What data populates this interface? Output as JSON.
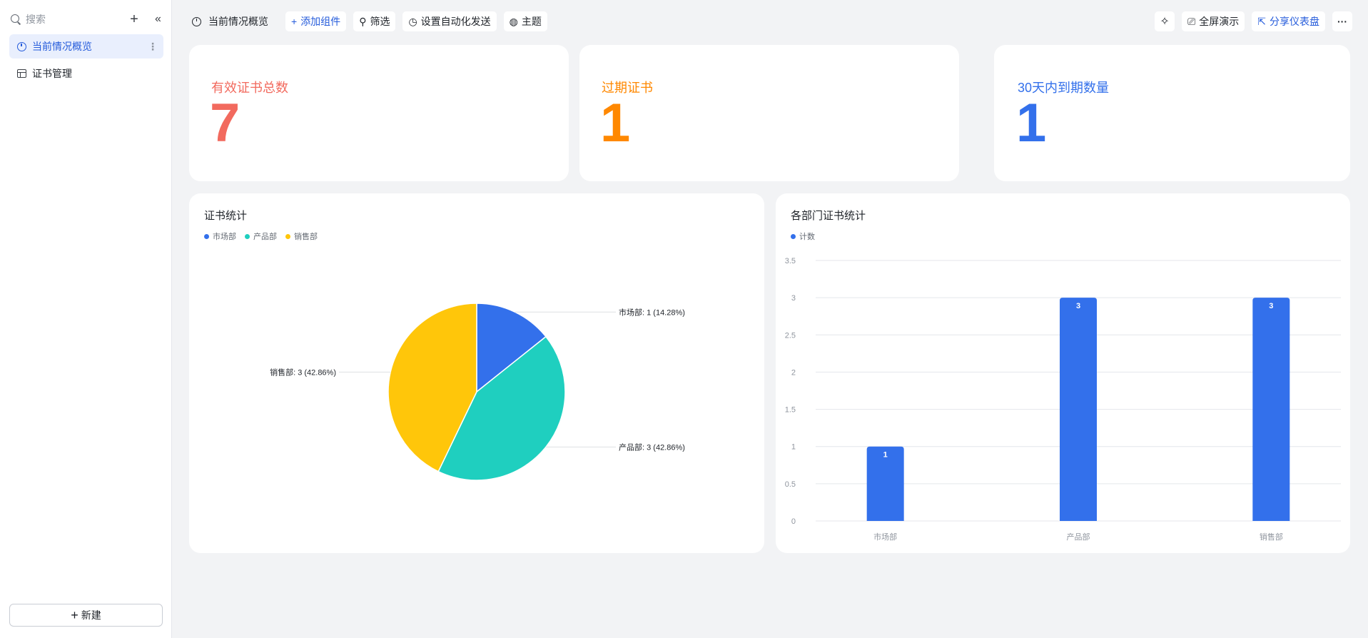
{
  "sidebar": {
    "search_placeholder": "搜索",
    "add_glyph": "+",
    "collapse_glyph": "«",
    "items": [
      {
        "label": "当前情况概览",
        "icon": "dashboard-clock-icon",
        "active": true
      },
      {
        "label": "证书管理",
        "icon": "table-icon",
        "active": false
      }
    ],
    "more_glyph": "⋮",
    "new_label": "新建",
    "new_glyph": "+"
  },
  "toolbar": {
    "title": "当前情况概览",
    "buttons": [
      {
        "label": "添加组件",
        "glyph": "+",
        "icon": "plus-icon"
      },
      {
        "label": "筛选",
        "glyph": "⚲",
        "icon": "filter-icon"
      },
      {
        "label": "设置自动化发送",
        "glyph": "◷",
        "icon": "automation-clock-icon"
      },
      {
        "label": "主题",
        "glyph": "◍",
        "icon": "theme-palette-icon"
      }
    ],
    "right": {
      "ai_glyph": "✧",
      "fullscreen_label": "全屏演示",
      "fullscreen_glyph": "⎚",
      "share_label": "分享仪表盘",
      "share_glyph": "⇱",
      "more_glyph": "···"
    }
  },
  "kpis": [
    {
      "label": "有效证书总数",
      "value": "7",
      "color": "#f26a5e"
    },
    {
      "label": "过期证书",
      "value": "1",
      "color": "#ff8800"
    },
    {
      "label": "30天内到期数量",
      "value": "1",
      "color": "#3370eb"
    }
  ],
  "chart_data": [
    {
      "type": "pie",
      "title": "证书统计",
      "legend": "top-left",
      "categories": [
        "市场部",
        "产品部",
        "销售部"
      ],
      "values": [
        1,
        3,
        3
      ],
      "percents": [
        "14.28%",
        "42.86%",
        "42.86%"
      ],
      "labels": [
        "市场部: 1 (14.28%)",
        "产品部: 3 (42.86%)",
        "销售部: 3 (42.86%)"
      ],
      "colors": [
        "#3370eb",
        "#1fcfbf",
        "#ffc60a"
      ]
    },
    {
      "type": "bar",
      "title": "各部门证书统计",
      "legend": "top-left",
      "series": [
        {
          "name": "计数",
          "values": [
            1,
            3,
            3
          ],
          "color": "#3370eb"
        }
      ],
      "categories": [
        "市场部",
        "产品部",
        "销售部"
      ],
      "yticks": [
        "0",
        "0.5",
        "1",
        "1.5",
        "2",
        "2.5",
        "3",
        "3.5"
      ],
      "ylim": [
        0,
        3.5
      ],
      "grid": true
    }
  ]
}
